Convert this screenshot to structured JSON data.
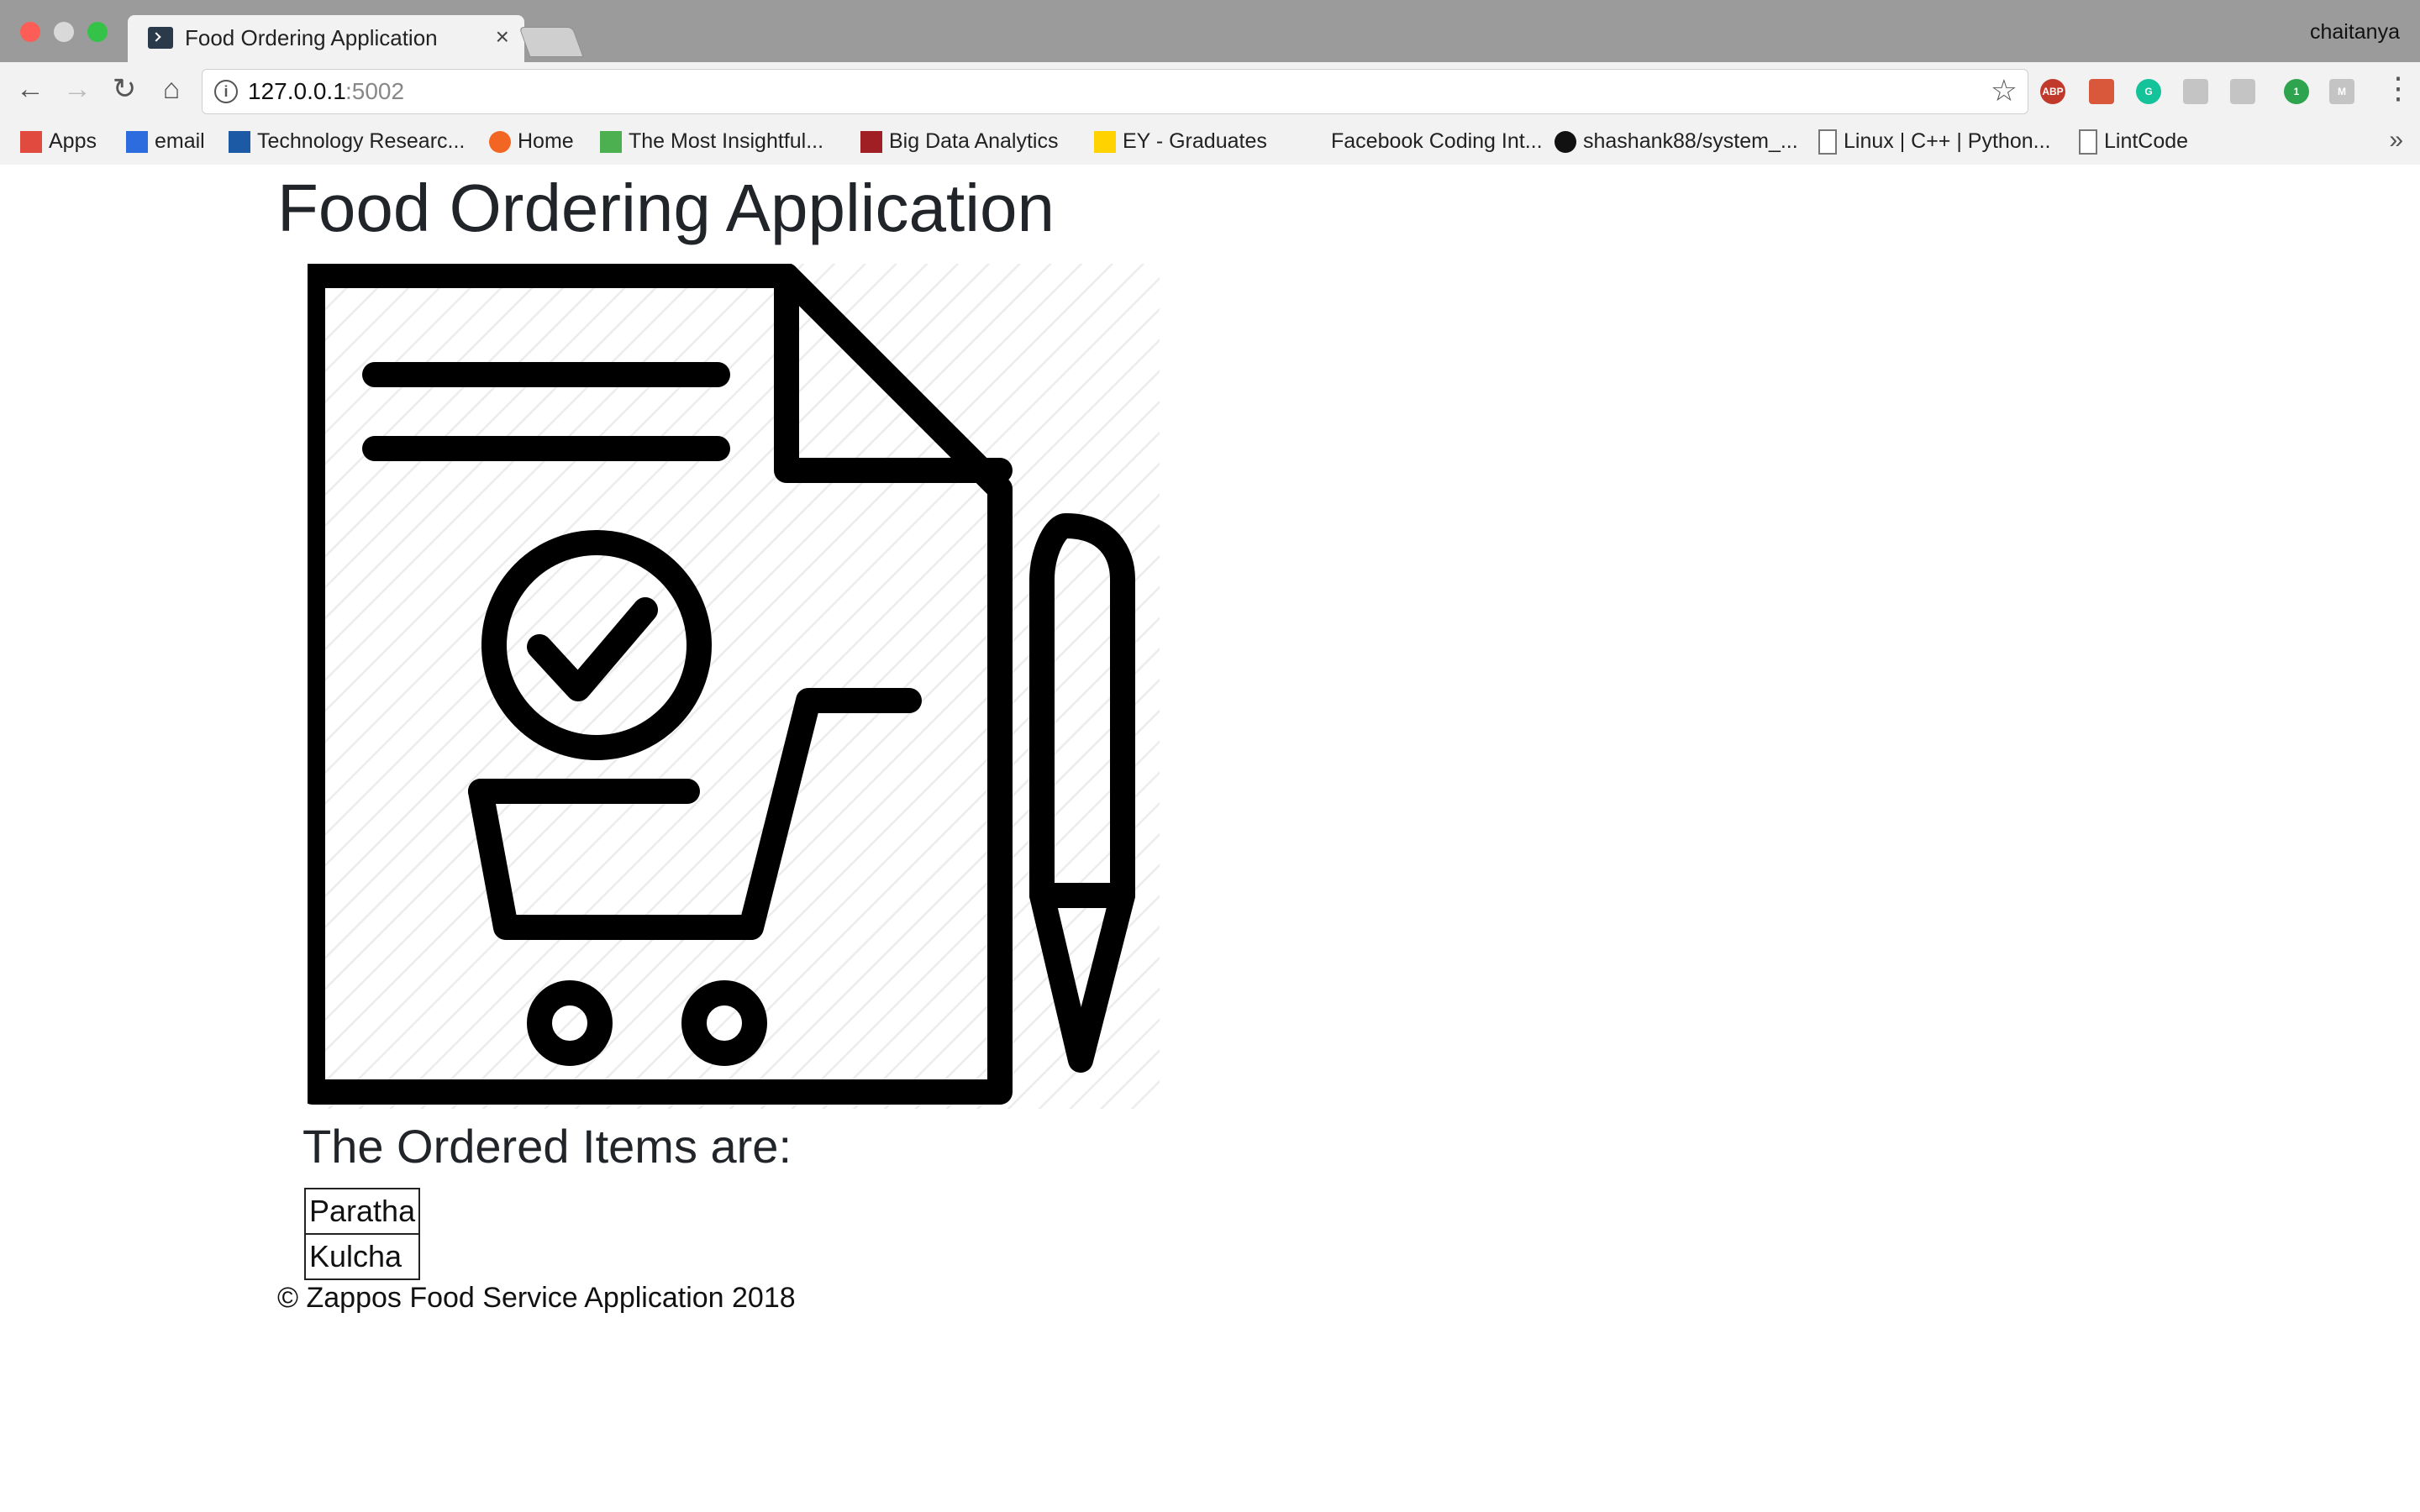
{
  "browser": {
    "tab_title": "Food Ordering Application",
    "tab_close": "×",
    "profile_name": "chaitanya",
    "url_host": "127.0.0.1",
    "url_port": ":5002",
    "icons": [
      "back-icon",
      "forward-icon",
      "reload-icon",
      "home-icon",
      "info-icon",
      "star-icon",
      "menu-icon"
    ],
    "extensions": [
      {
        "name": "abp-extension-icon",
        "label": "ABP",
        "color": "#c0392b"
      },
      {
        "name": "bookmark-extension-icon",
        "label": "",
        "color": "#d9573b"
      },
      {
        "name": "grammarly-extension-icon",
        "label": "G",
        "color": "#15c39a"
      },
      {
        "name": "gray-extension-icon-1",
        "label": "",
        "color": "#c4c4c4"
      },
      {
        "name": "gray-extension-icon-2",
        "label": "",
        "color": "#c4c4c4"
      },
      {
        "name": "green-extension-icon",
        "label": "1",
        "color": "#2ea44f"
      },
      {
        "name": "m-extension-icon",
        "label": "M",
        "color": "#c4c4c4"
      }
    ]
  },
  "bookmarks": [
    {
      "label": "Apps",
      "icon": "apps-grid-icon"
    },
    {
      "label": "email",
      "icon": "email-icon"
    },
    {
      "label": "Technology Researc...",
      "icon": "technology-icon"
    },
    {
      "label": "Home",
      "icon": "home-ring-icon"
    },
    {
      "label": "The Most Insightful...",
      "icon": "tree-icon"
    },
    {
      "label": "Big Data Analytics",
      "icon": "shield-icon"
    },
    {
      "label": "EY - Graduates",
      "icon": "ey-icon"
    },
    {
      "label": "Facebook Coding Int...",
      "icon": ""
    },
    {
      "label": "shashank88/system_...",
      "icon": "github-icon"
    },
    {
      "label": "Linux | C++ | Python...",
      "icon": "page-icon"
    },
    {
      "label": "LintCode",
      "icon": "page-icon"
    }
  ],
  "bookmarks_more": "»",
  "page": {
    "title": "Food Ordering Application",
    "ordered_heading": "The Ordered Items are:",
    "ordered_items": [
      "Paratha",
      "Kulcha"
    ],
    "footer": "© Zappos Food Service Application 2018"
  }
}
